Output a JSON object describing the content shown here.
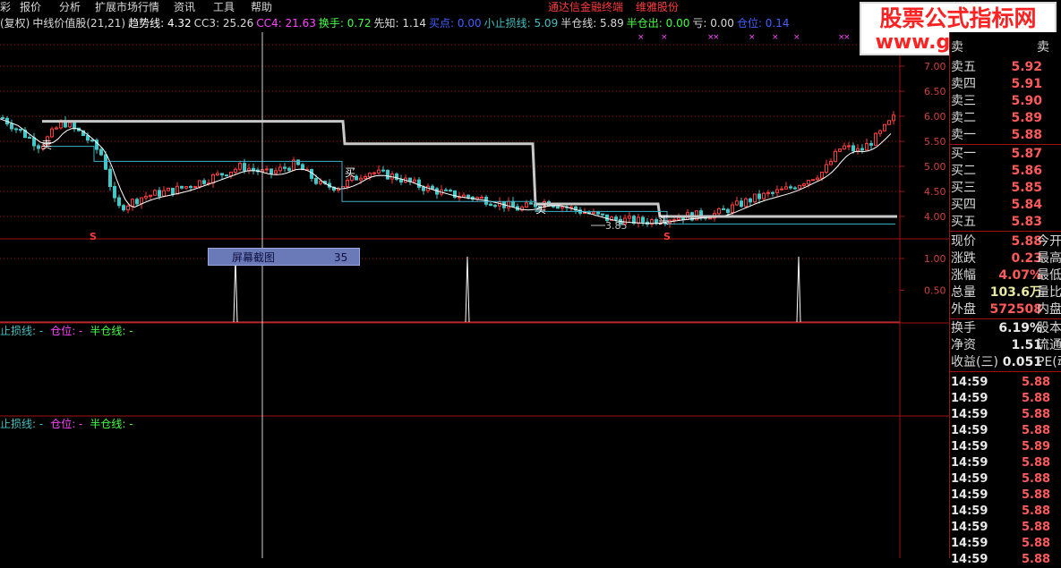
{
  "menu": {
    "items": [
      "彩",
      "报价",
      "分析",
      "扩展市场行情",
      "资讯",
      "工具",
      "帮助"
    ],
    "right_items": [
      "通达信金融终端",
      "维雅股份"
    ]
  },
  "watermark": {
    "line1": "股票公式指标网",
    "line2": "www.gszb.com"
  },
  "infobar": [
    {
      "text": "(复权)",
      "color": "#d8d8d8"
    },
    {
      "text": "中线价值股(21,21)",
      "color": "#d8d8d8"
    },
    {
      "text": "趋势线: 4.32",
      "color": "#ffffff"
    },
    {
      "text": "CC3: 25.26",
      "color": "#d8d8d8"
    },
    {
      "text": "CC4: 21.63",
      "color": "#ff44ff"
    },
    {
      "text": "换手: 0.72",
      "color": "#44ff44"
    },
    {
      "text": "先知: 1.14",
      "color": "#d8d8d8"
    },
    {
      "text": "买点: 0.00",
      "color": "#4060ff"
    },
    {
      "text": "小止损线: 5.09",
      "color": "#40c0c0"
    },
    {
      "text": "半仓线: 5.89",
      "color": "#d8d8d8"
    },
    {
      "text": "半仓出: 0.00",
      "color": "#44ff44"
    },
    {
      "text": "亏: 0.00",
      "color": "#d8d8d8"
    },
    {
      "text": "仓位: 0.14",
      "color": "#4060ff"
    }
  ],
  "main_chart": {
    "y_ticks": [
      "7.00",
      "6.50",
      "6.00",
      "5.50",
      "5.00",
      "4.50",
      "4.00"
    ],
    "sell_label": "卖",
    "buy_label": "买",
    "s_marker": "S",
    "low_label": "3.85"
  },
  "sub_chart": {
    "y_ticks": [
      "1.00",
      "0.50"
    ]
  },
  "tooltip": {
    "label": "屏幕截图",
    "value": "35"
  },
  "panel3": {
    "items": [
      {
        "text": "止损线: -",
        "color": "#40c0c0"
      },
      {
        "text": "仓位: -",
        "color": "#ff44ff"
      },
      {
        "text": "半仓线: -",
        "color": "#44ff44"
      }
    ]
  },
  "panel4": {
    "items": [
      {
        "text": "止损线: -",
        "color": "#40c0c0"
      },
      {
        "text": "仓位: -",
        "color": "#ff44ff"
      },
      {
        "text": "半仓线: -",
        "color": "#44ff44"
      }
    ]
  },
  "order_book": {
    "header_left": "卖",
    "header_right": "卖",
    "asks": [
      {
        "label": "卖五",
        "price": "5.92"
      },
      {
        "label": "卖四",
        "price": "5.91"
      },
      {
        "label": "卖三",
        "price": "5.90"
      },
      {
        "label": "卖二",
        "price": "5.89"
      },
      {
        "label": "卖一",
        "price": "5.88"
      }
    ],
    "bids": [
      {
        "label": "买一",
        "price": "5.87"
      },
      {
        "label": "买二",
        "price": "5.86"
      },
      {
        "label": "买三",
        "price": "5.85"
      },
      {
        "label": "买四",
        "price": "5.84"
      },
      {
        "label": "买五",
        "price": "5.83"
      }
    ]
  },
  "stats": [
    {
      "label": "现价",
      "value": "5.88",
      "tail": "今开",
      "cls": ""
    },
    {
      "label": "涨跌",
      "value": "0.23",
      "tail": "最高",
      "cls": ""
    },
    {
      "label": "涨幅",
      "value": "4.07%",
      "tail": "最低",
      "cls": ""
    },
    {
      "label": "总量",
      "value": "103.6万",
      "tail": "量比",
      "cls": "y"
    },
    {
      "label": "外盘",
      "value": "572508",
      "tail": "内盘",
      "cls": ""
    }
  ],
  "stats2": [
    {
      "label": "换手",
      "value": "6.19%",
      "tail": "股本",
      "cls": "w"
    },
    {
      "label": "净资",
      "value": "1.51",
      "tail": "流通",
      "cls": "w"
    },
    {
      "label": "收益(三)",
      "value": "0.051",
      "tail": "PE(动",
      "cls": "w"
    }
  ],
  "ticks": [
    {
      "time": "14:59",
      "price": "5.88"
    },
    {
      "time": "14:59",
      "price": "5.88"
    },
    {
      "time": "14:59",
      "price": "5.88"
    },
    {
      "time": "14:59",
      "price": "5.88"
    },
    {
      "time": "14:59",
      "price": "5.89"
    },
    {
      "time": "14:59",
      "price": "5.88"
    },
    {
      "time": "14:59",
      "price": "5.88"
    },
    {
      "time": "14:59",
      "price": "5.88"
    },
    {
      "time": "14:59",
      "price": "5.88"
    },
    {
      "time": "14:59",
      "price": "5.88"
    },
    {
      "time": "14:59",
      "price": "5.88"
    },
    {
      "time": "14:59",
      "price": "5.88"
    }
  ],
  "colors": {
    "up": "#ff3b3b",
    "down": "#40c8c8",
    "ma": "#ffffff",
    "trend": "#c8c8c8",
    "grid": "#a01010"
  }
}
